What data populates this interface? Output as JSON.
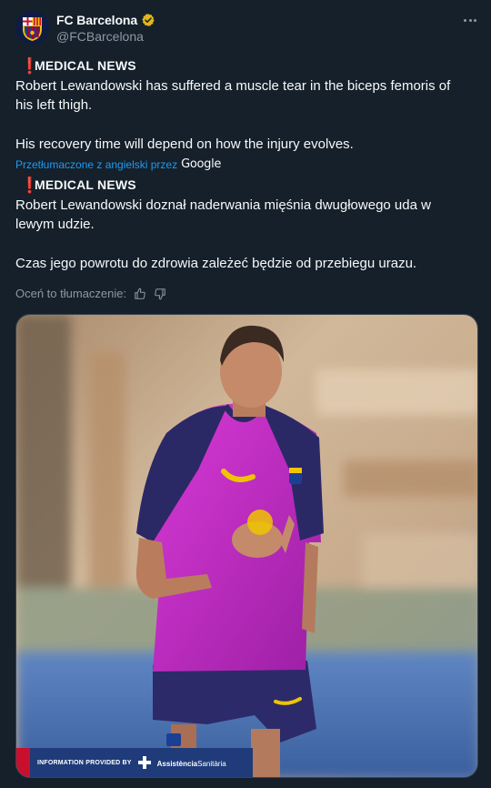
{
  "author": {
    "display_name": "FC Barcelona",
    "handle": "@FCBarcelona",
    "verified_icon": "verified-badge-icon",
    "avatar_icon": "fcb-crest-icon"
  },
  "original": {
    "heading_marker": "❗",
    "heading": "MEDICAL NEWS",
    "line1": "Robert Lewandowski has suffered a muscle tear in the biceps femoris of",
    "line2": "his left thigh.",
    "line3": "His recovery time will depend on how the injury evolves."
  },
  "translation_credit": {
    "label": "Przetłumaczone z angielski przez",
    "provider": "Google"
  },
  "translated": {
    "heading_marker": "❗",
    "heading": "MEDICAL NEWS",
    "line1": "Robert Lewandowski doznał naderwania mięśnia dwugłowego uda w",
    "line2": "lewym udzie.",
    "line3": "Czas jego powrotu do zdrowia zależeć będzie od przebiegu urazu."
  },
  "rate": {
    "label": "Oceń to tłumaczenie:",
    "thumbs_up": "thumbs-up-icon",
    "thumbs_down": "thumbs-down-icon"
  },
  "media": {
    "banner_text": "INFORMATION PROVIDED BY",
    "banner_brand_a": "Assistència",
    "banner_brand_b": "Sanitària"
  },
  "colors": {
    "background": "#15202b",
    "link": "#1d9bf0",
    "muted": "#8b98a5",
    "shirt": "#c026c8",
    "alert": "#e0245e"
  }
}
